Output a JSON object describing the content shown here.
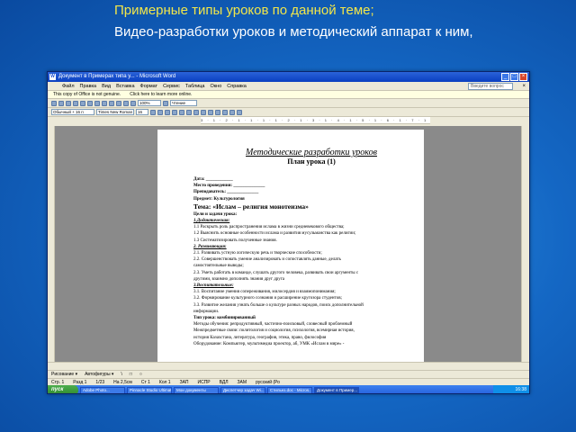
{
  "slide": {
    "bullets": [
      {
        "mark": "",
        "text": "Примерные типы уроков по данной теме;"
      },
      {
        "mark": "",
        "text": "Видео-разработки уроков и методический аппарат к ним,"
      }
    ]
  },
  "window": {
    "title": "Документ в Примерах типа у... - Microsoft Word",
    "icon_letter": "W",
    "controls": [
      "_",
      "□",
      "×"
    ]
  },
  "menu": {
    "items": [
      "Файл",
      "Правка",
      "Вид",
      "Вставка",
      "Формат",
      "Сервис",
      "Таблица",
      "Окно",
      "Справка"
    ],
    "help_placeholder": "Введите вопрос",
    "close": "×"
  },
  "infobar": {
    "message": "This copy of Office is not genuine.",
    "link": "Click here to learn more online."
  },
  "toolbar": {
    "style": "Обычный + 16 п",
    "font": "Times New Roman",
    "size": "16",
    "zoom": "100%",
    "reading": "Чтение"
  },
  "ruler": {
    "text": "3 · 1 · 2 · 1 · 1 · 1 · 1 · 2 · 1 · 3 · 1 · 4 · 1 · 5 · 1 · 6 · 1 · 7 · 1 · 8 · 1 · 9 · 1 · 10 · 1 · 11 · 1 · 12 · 1 · 13 · 1 · 14 · 1 · 15 · 1 · 16 · 1 · 17"
  },
  "document": {
    "heading": "Методические разработки уроков",
    "subheading": "План урока (1)",
    "lines": [
      {
        "text": "Дата: ____________",
        "style": "bold"
      },
      {
        "text": "Место проведения: ______________",
        "style": "bold"
      },
      {
        "text": "Преподаватель: ______________",
        "style": "bold"
      },
      {
        "text": "Предмет: Культурология",
        "style": "bold"
      },
      {
        "text": "Тема: «Ислам – религия монотеизма»",
        "style": "big"
      },
      {
        "text": "Цели и задачи урока:",
        "style": "bold"
      },
      {
        "text": "1.Дидактическая:",
        "style": "section"
      },
      {
        "text": "1.1 Раскрыть роль распространения ислама в жизни средневекового общества;",
        "style": "normal"
      },
      {
        "text": "1.2 Выяснить основные особенности ислама и развития мусульманства как религии;",
        "style": "normal"
      },
      {
        "text": "1.3 Систематизировать полученные знания.",
        "style": "normal"
      },
      {
        "text": "2. Развивающая:",
        "style": "section"
      },
      {
        "text": "2.1. Развивать устную логическую речь и творческие способности;",
        "style": "normal"
      },
      {
        "text": "2.2. Совершенствовать умение анализировать и сопоставлять данные, делать",
        "style": "normal"
      },
      {
        "text": "самостоятельные выводы;",
        "style": "normal"
      },
      {
        "text": "2.3. Уметь работать в команде, слушать другого человека, развивать свои аргументы с",
        "style": "normal"
      },
      {
        "text": "другими, взаимно дополнять знания друг друга",
        "style": "normal"
      },
      {
        "text": "3.Воспитательные:",
        "style": "section"
      },
      {
        "text": "3.1. Воспитание умения сопереживания, милосердия и взаимопонимания;",
        "style": "normal"
      },
      {
        "text": "3.2. Формирование культурного  сознания и расширение кругозора студентов;",
        "style": "normal"
      },
      {
        "text": "3.3. Развитие желания узнать больше о культуре разных народов, поиск дополнительной",
        "style": "normal"
      },
      {
        "text": "информации.",
        "style": "normal"
      },
      {
        "text": "Тип урока: комбинированный",
        "style": "bold"
      },
      {
        "text": "Методы обучения: репродуктивный, частично-поисковый, словесный проблемный",
        "style": "normal"
      },
      {
        "text": "Межпредметные связи: политология и социология, психология, всемирная история,",
        "style": "normal"
      },
      {
        "text": "история Казахстана, литература, география, этика, право, философия",
        "style": "normal"
      },
      {
        "text": "Оборудование: Компьютер, мультимедиа проектор, аб, УМК «Ислам в мире» -",
        "style": "normal"
      }
    ]
  },
  "drawbar": {
    "items": [
      "Рисование ▾",
      "Автофигуры ▾",
      "\\",
      "□",
      "○"
    ]
  },
  "statusbar": {
    "items": [
      "Стр. 1",
      "Разд 1",
      "1/23",
      "На 2,5см",
      "Ст 1",
      "Кол 1",
      "ЗАП",
      "ИСПР",
      "ВДЛ",
      "ЗАМ",
      "русский (Ро"
    ]
  },
  "taskbar": {
    "start": "пуск",
    "buttons": [
      "Adobe Photo...",
      "Pinnacle Studio Ultimat...",
      "Мои документы",
      "Диспетчер задач Wi...",
      "Стильнз.doc - Micros...",
      "Документ в Пример..."
    ],
    "clock": "16:38"
  }
}
